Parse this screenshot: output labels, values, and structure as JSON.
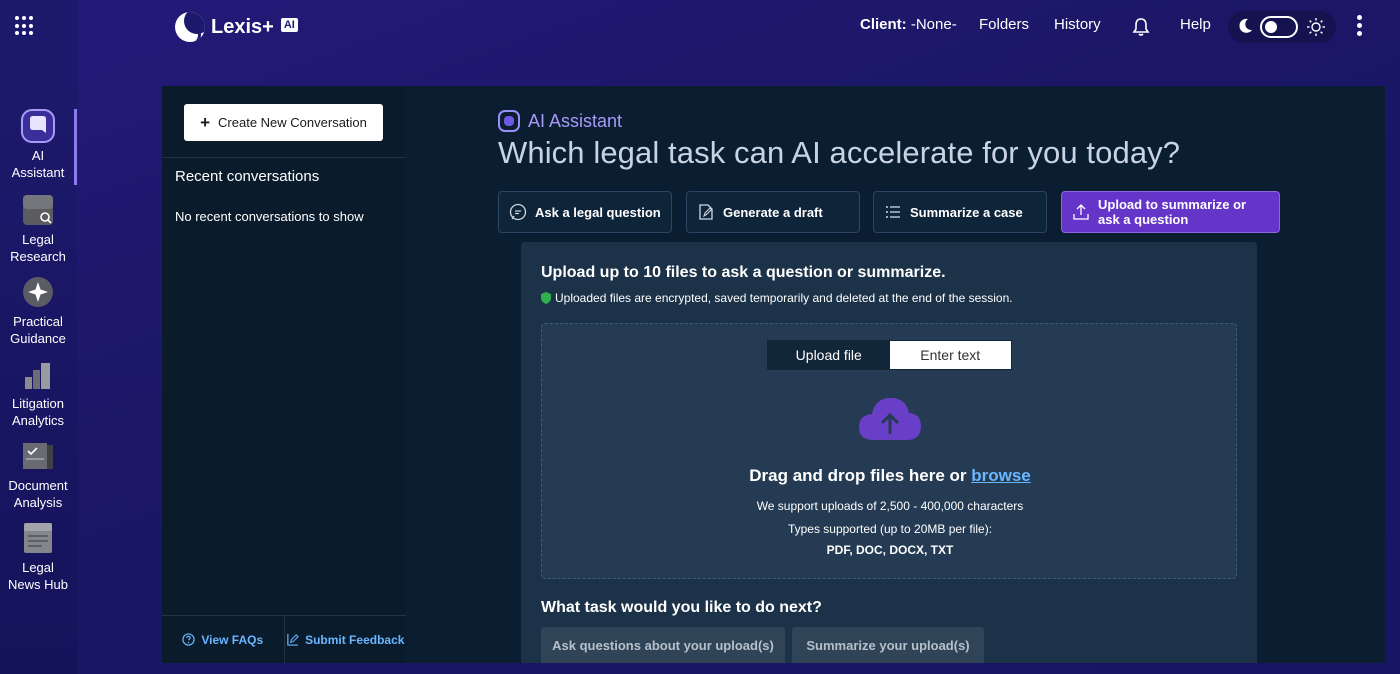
{
  "app": {
    "brand": "Lexis+",
    "brand_badge": "AI",
    "brand_sup": "®"
  },
  "header": {
    "client_label": "Client:",
    "client_value": "-None-",
    "folders": "Folders",
    "history": "History",
    "help": "Help",
    "theme_toggle": "off"
  },
  "rail": {
    "items": [
      {
        "label": "AI\nAssistant",
        "icon": "ai-assistant-icon",
        "active": true
      },
      {
        "label": "Legal\nResearch",
        "icon": "legal-research-icon"
      },
      {
        "label": "Practical\nGuidance",
        "icon": "practical-guidance-icon"
      },
      {
        "label": "Litigation\nAnalytics",
        "icon": "litigation-analytics-icon"
      },
      {
        "label": "Document\nAnalysis",
        "icon": "document-analysis-icon"
      },
      {
        "label": "Legal\nNews Hub",
        "icon": "legal-news-hub-icon"
      }
    ]
  },
  "sidebar": {
    "create_button": "Create New Conversation",
    "recent_title": "Recent conversations",
    "recent_empty": "No recent conversations to show",
    "faq_link": "View FAQs",
    "feedback_link": "Submit Feedback"
  },
  "main": {
    "tag": "AI Assistant",
    "headline": "Which legal task can AI accelerate for you today?",
    "tasks": [
      {
        "label": "Ask a legal question",
        "icon": "chat-bubble-icon"
      },
      {
        "label": "Generate a draft",
        "icon": "draft-icon"
      },
      {
        "label": "Summarize a case",
        "icon": "list-icon"
      },
      {
        "label": "Upload to summarize or ask a question",
        "icon": "upload-icon",
        "selected": true
      }
    ],
    "upload": {
      "title": "Upload up to 10 files to ask a question or summarize.",
      "note": "Uploaded files are encrypted, saved temporarily and deleted at the end of the session.",
      "tab_upload": "Upload file",
      "tab_text": "Enter text",
      "drag_text": "Drag and drop files here or ",
      "browse": "browse",
      "support_line": "We support uploads of 2,500 - 400,000 characters",
      "types_line": "Types supported (up to 20MB per file):",
      "formats": "PDF, DOC, DOCX, TXT"
    },
    "next": {
      "title": "What task would you like to do next?",
      "ask_button": "Ask questions about your upload(s)",
      "summarize_button": "Summarize your upload(s)"
    }
  },
  "colors": {
    "accent": "#6535c9",
    "link": "#6ab6ff",
    "panel_bg": "#0b1e31",
    "header_bg": "#1d1a6e"
  }
}
